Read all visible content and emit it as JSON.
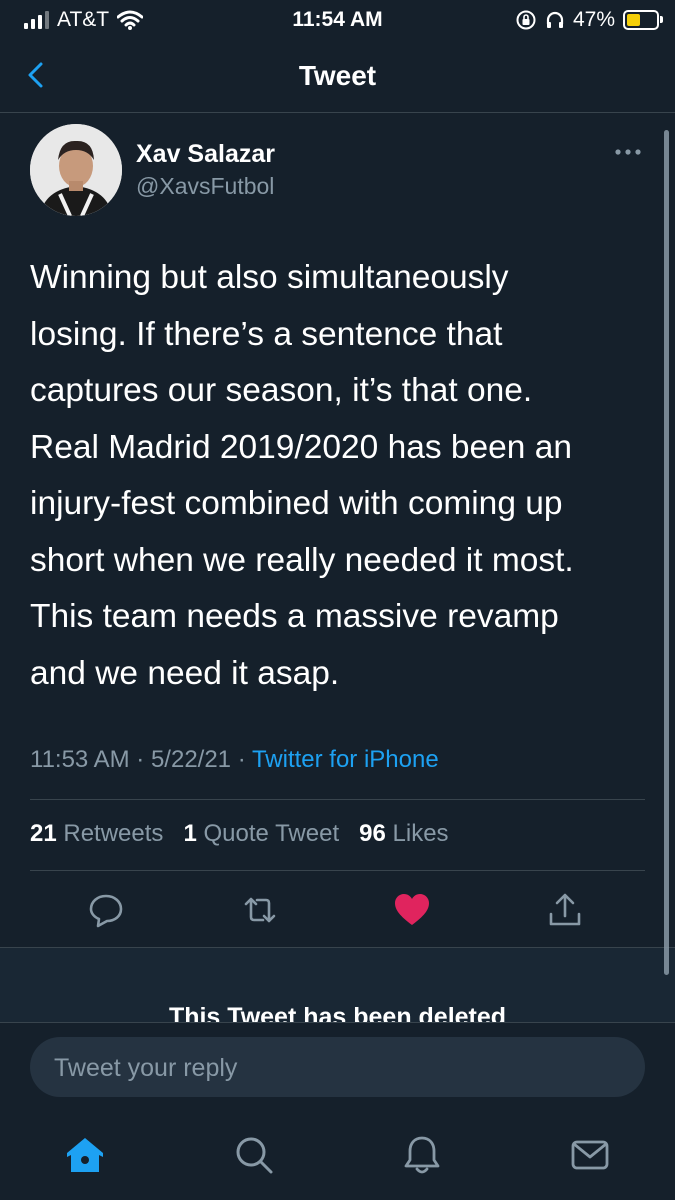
{
  "status_bar": {
    "carrier": "AT&T",
    "time": "11:54 AM",
    "battery_percent": "47%",
    "battery_level": 0.47,
    "battery_color": "#f5d00a"
  },
  "header": {
    "title": "Tweet",
    "back_icon": "chevron-left-icon"
  },
  "tweet": {
    "author_name": "Xav Salazar",
    "author_handle": "@XavsFutbol",
    "text": "Winning but also simultaneously\nlosing. If there’s a sentence that\ncaptures our season, it’s that one.\nReal Madrid 2019/2020 has been an\ninjury-fest combined with coming up\nshort when we really needed it most.\nThis team needs a massive revamp\nand we need it asap.",
    "time": "11:53 AM",
    "sep1": " · ",
    "date": "5/22/21",
    "sep2": " · ",
    "source": "Twitter for iPhone",
    "retweets_count": "21",
    "retweets_label": "Retweets",
    "quotes_count": "1",
    "quotes_label": "Quote Tweet",
    "likes_count": "96",
    "likes_label": "Likes",
    "liked": true
  },
  "actions": [
    "reply-icon",
    "retweet-icon",
    "like-icon",
    "share-icon"
  ],
  "deleted_notice": "This Tweet has been deleted",
  "reply": {
    "placeholder": "Tweet your reply"
  },
  "tabs": [
    "home-icon",
    "search-icon",
    "notifications-icon",
    "messages-icon"
  ],
  "colors": {
    "background": "#15202b",
    "accent": "#1da1f2",
    "like": "#e0245e",
    "muted": "#8899a6"
  }
}
